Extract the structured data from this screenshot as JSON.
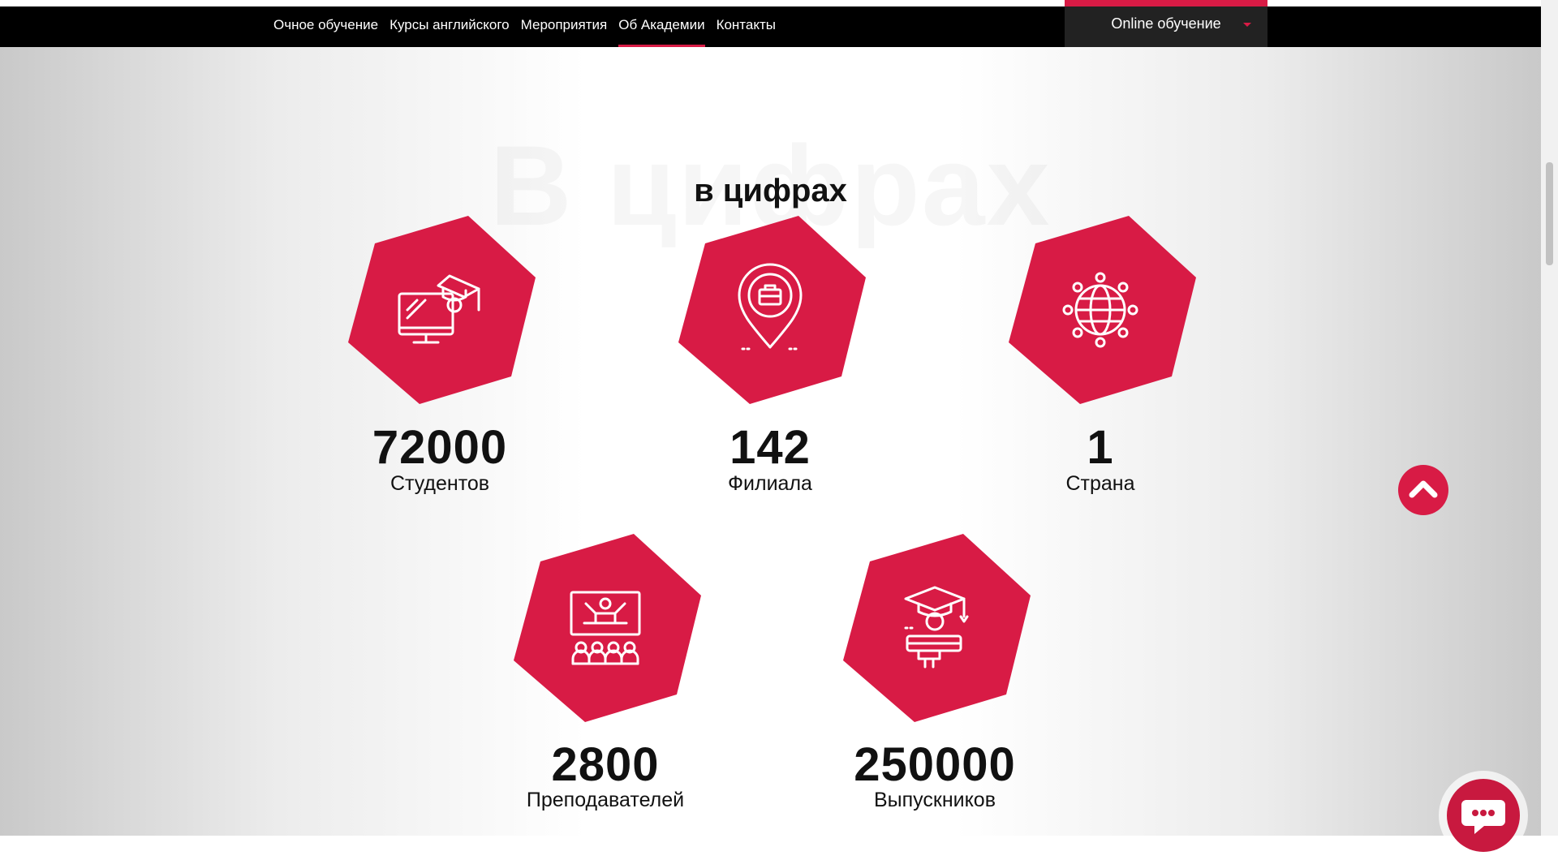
{
  "nav": {
    "links": [
      "Очное обучение",
      "Курсы английского",
      "Мероприятия",
      "Об Академии",
      "Контакты"
    ],
    "active": "Об Академии",
    "online_button": "Online обучение"
  },
  "section": {
    "background_title": "В цифрах",
    "title": "в цифрах"
  },
  "stats": [
    {
      "number": "72000",
      "label": "Студентов",
      "icon": "monitor-graduation-icon"
    },
    {
      "number": "142",
      "label": "Филиала",
      "icon": "location-pin-briefcase-icon"
    },
    {
      "number": "1",
      "label": "Страна",
      "icon": "globe-network-icon"
    },
    {
      "number": "2800",
      "label": "Преподавателей",
      "icon": "lecture-teacher-icon"
    },
    {
      "number": "250000",
      "label": "Выпускников",
      "icon": "graduate-diploma-icon"
    }
  ],
  "colors": {
    "accent": "#d81b45",
    "navbar": "#000000",
    "text": "#111111"
  }
}
